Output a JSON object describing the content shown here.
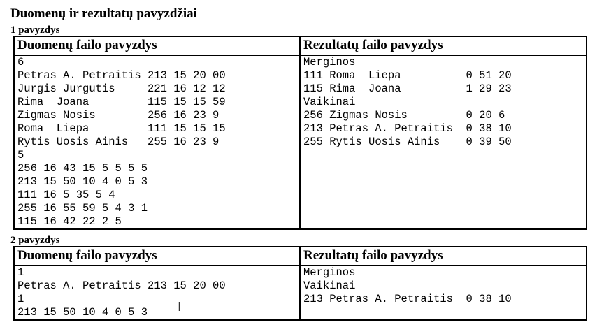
{
  "document": {
    "title": "Duomenų ir rezultatų pavyzdžiai"
  },
  "examples": [
    {
      "label": "1 pavyzdys",
      "input_header": "Duomenų failo pavyzdys",
      "output_header": "Rezultatų failo pavyzdys",
      "input_lines": [
        "6",
        "Petras A. Petraitis 213 15 20 00",
        "Jurgis Jurgutis     221 16 12 12",
        "Rima  Joana         115 15 15 59",
        "Zigmas Nosis        256 16 23 9",
        "Roma  Liepa         111 15 15 15",
        "Rytis Uosis Ainis   255 16 23 9",
        "5",
        "256 16 43 15 5 5 5 5",
        "213 15 50 10 4 0 5 3",
        "111 16 5 35 5 4",
        "255 16 55 59 5 4 3 1",
        "115 16 42 22 2 5"
      ],
      "output_lines": [
        "Merginos",
        "111 Roma  Liepa          0 51 20",
        "115 Rima  Joana          1 29 23",
        "Vaikinai",
        "256 Zigmas Nosis         0 20 6",
        "213 Petras A. Petraitis  0 38 10",
        "255 Rytis Uosis Ainis    0 39 50"
      ]
    },
    {
      "label": "2 pavyzdys",
      "input_header": "Duomenų failo pavyzdys",
      "output_header": "Rezultatų failo pavyzdys",
      "input_lines": [
        "1",
        "Petras A. Petraitis 213 15 20 00",
        "1",
        "213 15 50 10 4 0 5 3"
      ],
      "output_lines": [
        "Merginos",
        "Vaikinai",
        "213 Petras A. Petraitis  0 38 10"
      ]
    }
  ],
  "cursor": {
    "icon": "text-cursor-icon",
    "glyph": "I"
  }
}
